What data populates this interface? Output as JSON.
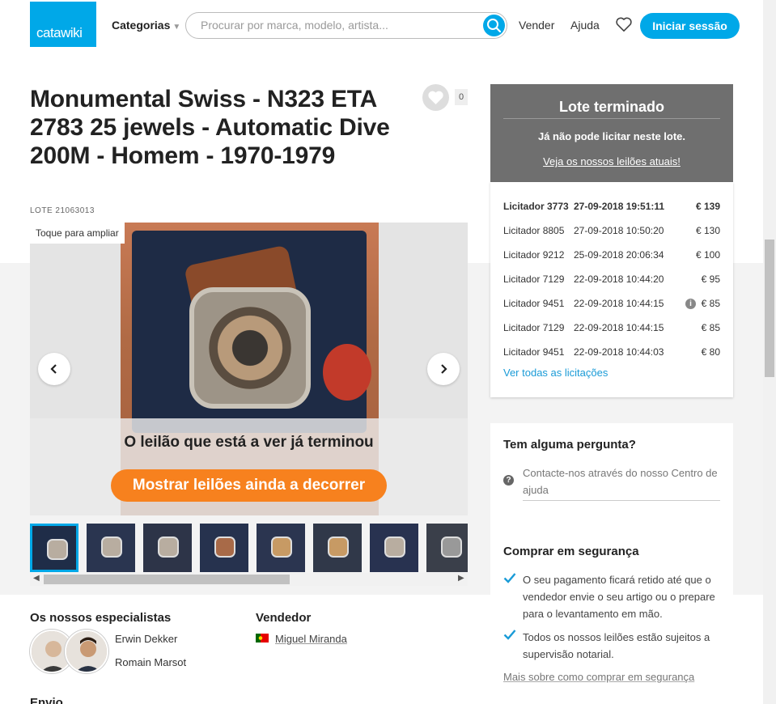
{
  "header": {
    "logo": "catawiki",
    "categories_label": "Categorias",
    "search_placeholder": "Procurar por marca, modelo, artista...",
    "sell_label": "Vender",
    "help_label": "Ajuda",
    "login_label": "Iniciar sessão",
    "accent_color": "#00a8e8"
  },
  "lot": {
    "title": "Monumental Swiss - N323 ETA 2783 25 jewels - Automatic Dive 200M - Homem - 1970-1979",
    "lot_number": "LOTE 21063013",
    "favorite_count": "0"
  },
  "gallery": {
    "zoom_hint": "Toque para ampliar",
    "ended_message": "O leilão que está a ver já terminou",
    "show_running_button": "Mostrar leilões ainda a decorrer",
    "button_color": "#f7811e",
    "thumbnail_count": 8,
    "selected_thumbnail": 1
  },
  "experts": {
    "heading": "Os nossos especialistas",
    "names": [
      "Erwin Dekker",
      "Romain Marsot"
    ]
  },
  "seller": {
    "heading": "Vendedor",
    "name": "Miguel Miranda",
    "country_flag": "portugal-flag"
  },
  "shipping": {
    "heading": "Envio"
  },
  "status_panel": {
    "heading": "Lote terminado",
    "subtitle": "Já não pode licitar neste lote.",
    "link": "Veja os nossos leilões atuais!"
  },
  "bids": {
    "rows": [
      {
        "bidder": "Licitador 3773",
        "date": "27-09-2018 19:51:11",
        "amount": "€ 139"
      },
      {
        "bidder": "Licitador 8805",
        "date": "27-09-2018 10:50:20",
        "amount": "€ 130"
      },
      {
        "bidder": "Licitador 9212",
        "date": "25-09-2018 20:06:34",
        "amount": "€ 100"
      },
      {
        "bidder": "Licitador 7129",
        "date": "22-09-2018 10:44:20",
        "amount": "€ 95"
      },
      {
        "bidder": "Licitador 9451",
        "date": "22-09-2018 10:44:15",
        "amount": "€ 85"
      },
      {
        "bidder": "Licitador 7129",
        "date": "22-09-2018 10:44:15",
        "amount": "€ 85"
      },
      {
        "bidder": "Licitador 9451",
        "date": "22-09-2018 10:44:03",
        "amount": "€ 80"
      }
    ],
    "all_bids_link": "Ver todas as licitações"
  },
  "questions": {
    "heading": "Tem alguma pergunta?",
    "contact_text": "Contacte-nos através do nosso Centro de ajuda"
  },
  "safe_buying": {
    "heading": "Comprar em segurança",
    "points": [
      "O seu pagamento ficará retido até que o vendedor envie o seu artigo ou o prepare para o levantamento em mão.",
      "Todos os nossos leilões estão sujeitos a supervisão notarial."
    ],
    "more_link": "Mais sobre como comprar em segurança"
  }
}
